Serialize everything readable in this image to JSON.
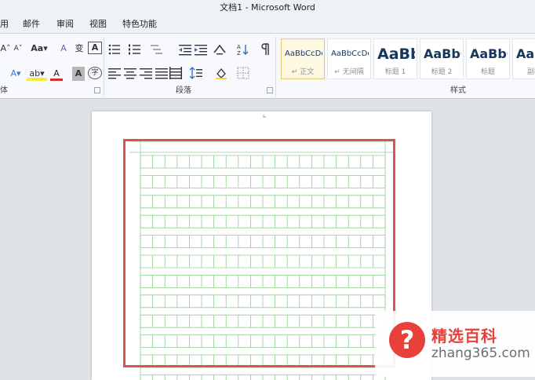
{
  "window": {
    "title": "文档1 - Microsoft Word"
  },
  "menu": {
    "items": [
      "用",
      "邮件",
      "审阅",
      "视图",
      "特色功能"
    ]
  },
  "ribbon": {
    "font_group_label": "体",
    "paragraph_group_label": "段落",
    "styles_group_label": "样式",
    "font_size_up": "A˄",
    "font_size_down": "A˅",
    "change_case": "Aa▾",
    "clear_format": "A",
    "phonetic": "变",
    "char_border": "A",
    "text_effect": "A▾",
    "highlight": "ab▾",
    "font_color": "A",
    "char_shading": "A",
    "enclose_char": "字"
  },
  "styles": [
    {
      "sample": "AaBbCcDd",
      "name": "↵ 正文",
      "size": 10
    },
    {
      "sample": "AaBbCcDd",
      "name": "↵ 无间隔",
      "size": 10
    },
    {
      "sample": "AaBb",
      "name": "标题 1",
      "size": 19
    },
    {
      "sample": "AaBbC",
      "name": "标题 2",
      "size": 16
    },
    {
      "sample": "AaBbC",
      "name": "标题",
      "size": 16
    },
    {
      "sample": "AaB",
      "name": "副标",
      "size": 16
    }
  ],
  "watermark": {
    "symbol": "?",
    "title": "精选百科",
    "domain": "zhang365.com"
  },
  "colors": {
    "grid": "#8fcf8f",
    "highlight_box": "#d9534f",
    "watermark_red": "#e8403a"
  }
}
